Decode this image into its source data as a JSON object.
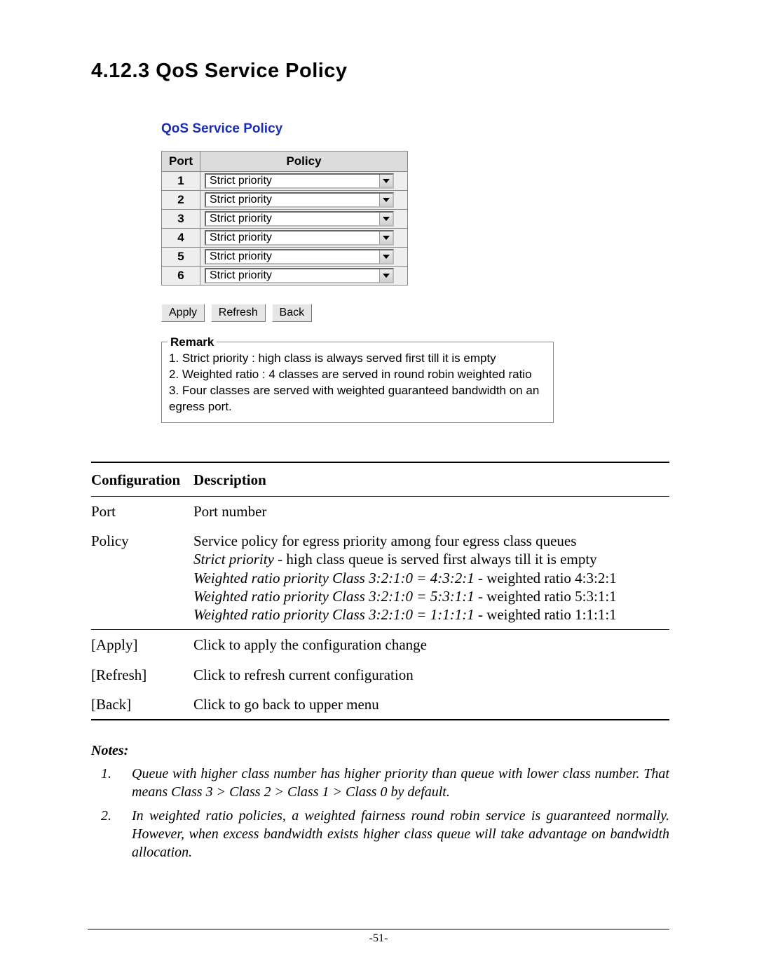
{
  "section_number": "4.12.3",
  "section_title": "QoS Service Policy",
  "ui": {
    "title": "QoS Service Policy",
    "table_headers": {
      "port": "Port",
      "policy": "Policy"
    },
    "rows": [
      {
        "port": "1",
        "policy": "Strict priority"
      },
      {
        "port": "2",
        "policy": "Strict priority"
      },
      {
        "port": "3",
        "policy": "Strict priority"
      },
      {
        "port": "4",
        "policy": "Strict priority"
      },
      {
        "port": "5",
        "policy": "Strict priority"
      },
      {
        "port": "6",
        "policy": "Strict priority"
      }
    ],
    "buttons": {
      "apply": "Apply",
      "refresh": "Refresh",
      "back": "Back"
    },
    "remark_legend": "Remark",
    "remarks": [
      "1. Strict priority : high class is always served first till it is empty",
      "2. Weighted ratio : 4 classes are served in round robin weighted ratio",
      "3. Four classes are served with weighted guaranteed bandwidth on an egress port."
    ]
  },
  "desc": {
    "header_cfg": "Configuration",
    "header_desc": "Description",
    "rows1": [
      {
        "k": "Port",
        "v_plain": "Port number"
      }
    ],
    "policy": {
      "k": "Policy",
      "line1": "Service policy for egress priority among four egress class queues",
      "line2_i": "Strict priority",
      "line2_rest": " - high class queue is served first always till it is empty",
      "line3_i": "Weighted ratio priority Class 3:2:1:0 = 4:3:2:1",
      "line3_rest": " - weighted ratio 4:3:2:1",
      "line4_i": "Weighted ratio priority Class 3:2:1:0 = 5:3:1:1",
      "line4_rest": " - weighted ratio 5:3:1:1",
      "line5_i": "Weighted ratio priority Class 3:2:1:0 = 1:1:1:1",
      "line5_rest": " - weighted ratio 1:1:1:1"
    },
    "rows2": [
      {
        "k": "[Apply]",
        "v": "Click to apply the configuration change"
      },
      {
        "k": "[Refresh]",
        "v": "Click to refresh current configuration"
      },
      {
        "k": "[Back]",
        "v": "Click to go back to upper menu"
      }
    ]
  },
  "notes": {
    "title": "Notes:",
    "items": [
      {
        "n": "1.",
        "t": "Queue with higher class number has higher priority than queue with lower class number. That means Class 3 > Class 2 > Class 1 > Class 0 by default."
      },
      {
        "n": "2.",
        "t": "In weighted ratio policies, a weighted fairness round robin service is guaranteed normally. However, when excess bandwidth exists higher class queue will take advantage on bandwidth allocation."
      }
    ]
  },
  "page_number": "-51-"
}
